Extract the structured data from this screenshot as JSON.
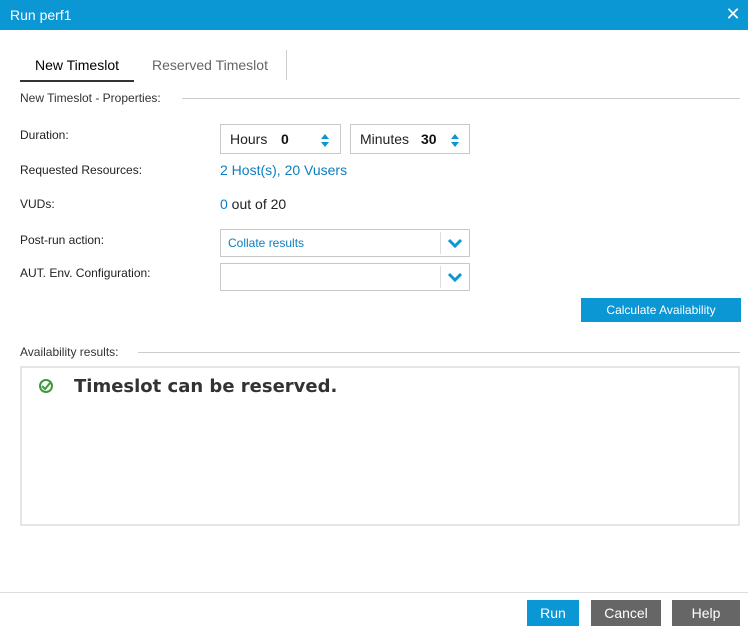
{
  "window": {
    "title": "Run perf1",
    "close_glyph": "✕"
  },
  "tabs": [
    {
      "label": "New Timeslot",
      "active": true
    },
    {
      "label": "Reserved Timeslot",
      "active": false
    }
  ],
  "properties_section": {
    "label": "New Timeslot - Properties:"
  },
  "duration": {
    "label": "Duration:",
    "hours_label": "Hours",
    "hours_value": "0",
    "minutes_label": "Minutes",
    "minutes_value": "30"
  },
  "requested_resources": {
    "label": "Requested Resources:",
    "value": "2 Host(s), 20 Vusers"
  },
  "vuds": {
    "label": "VUDs:",
    "value": "0",
    "suffix": " out of 20"
  },
  "post_run_action": {
    "label": "Post-run action:",
    "value": "Collate results"
  },
  "aut_env": {
    "label": "AUT. Env. Configuration:",
    "value": ""
  },
  "calculate_button": "Calculate Availability",
  "availability_section": {
    "label": "Availability results:"
  },
  "availability_message": "Timeslot can be reserved.",
  "footer": {
    "run": "Run",
    "cancel": "Cancel",
    "help": "Help"
  },
  "colors": {
    "accent": "#0b96d4",
    "link": "#0b7fc1",
    "secondary_button": "#666666"
  }
}
